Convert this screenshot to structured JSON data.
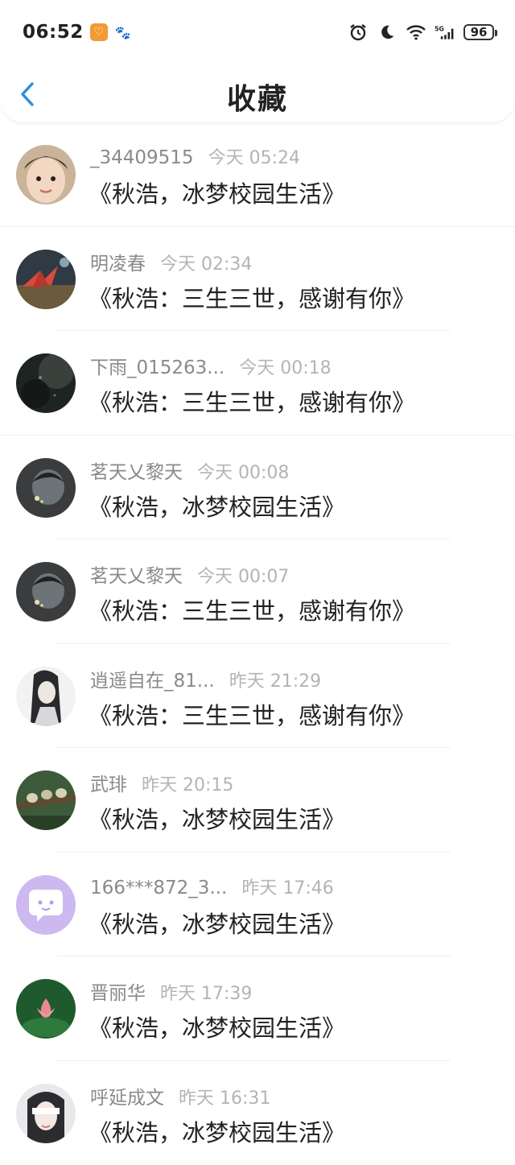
{
  "status": {
    "time": "06:52",
    "battery": "96",
    "network": "5G"
  },
  "header": {
    "title": "收藏"
  },
  "items": [
    {
      "name": "_34409515",
      "time": "今天 05:24",
      "message": "《秋浩，冰梦校园生活》",
      "avatar": "child-photo"
    },
    {
      "name": "明凌春",
      "time": "今天 02:34",
      "message": "《秋浩：三生三世，感谢有你》",
      "avatar": "paper-crane"
    },
    {
      "name": "下雨_015263...",
      "time": "今天 00:18",
      "message": "《秋浩：三生三世，感谢有你》",
      "avatar": "dark-texture"
    },
    {
      "name": "茗天乂黎天",
      "time": "今天 00:08",
      "message": "《秋浩，冰梦校园生活》",
      "avatar": "anime-dark"
    },
    {
      "name": "茗天乂黎天",
      "time": "今天 00:07",
      "message": "《秋浩：三生三世，感谢有你》",
      "avatar": "anime-dark"
    },
    {
      "name": "逍遥自在_81...",
      "time": "昨天 21:29",
      "message": "《秋浩：三生三世，感谢有你》",
      "avatar": "ink-girl"
    },
    {
      "name": "武琲",
      "time": "昨天 20:15",
      "message": "《秋浩，冰梦校园生活》",
      "avatar": "birds"
    },
    {
      "name": "166***872_3...",
      "time": "昨天 17:46",
      "message": "《秋浩，冰梦校园生活》",
      "avatar": "chat-bubble"
    },
    {
      "name": "晋丽华",
      "time": "昨天 17:39",
      "message": "《秋浩，冰梦校园生活》",
      "avatar": "lotus"
    },
    {
      "name": "呼延成文",
      "time": "昨天 16:31",
      "message": "《秋浩，冰梦校园生活》",
      "avatar": "girl-blindfold"
    }
  ]
}
